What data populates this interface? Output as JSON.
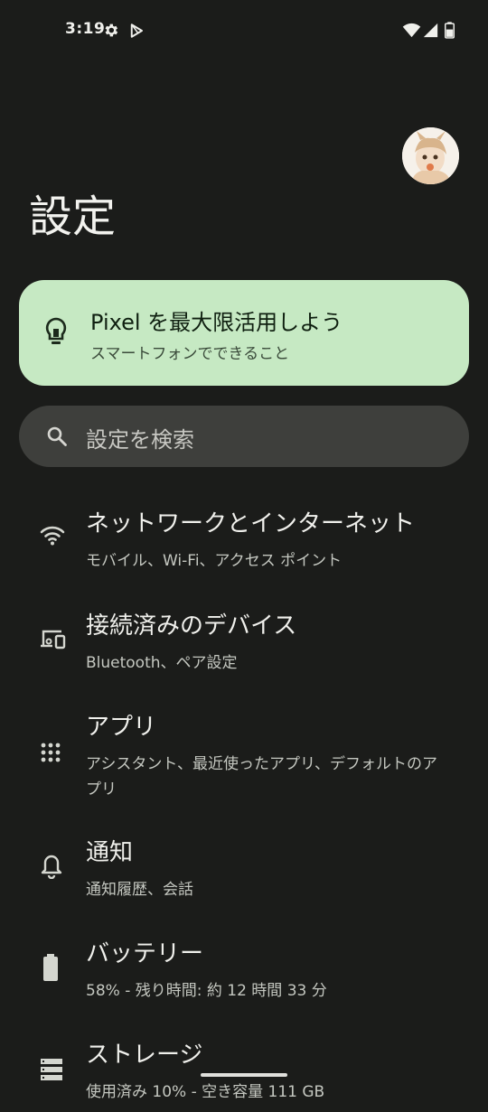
{
  "status_bar": {
    "time": "3:19",
    "icons_left": [
      "gear-icon",
      "play-store-icon"
    ],
    "icons_right": [
      "wifi-icon",
      "cellular-signal-icon",
      "battery-icon"
    ]
  },
  "header": {
    "title": "設定",
    "avatar": "profile-avatar"
  },
  "tips_card": {
    "title": "Pixel を最大限活用しよう",
    "subtitle": "スマートフォンでできること",
    "icon": "lightbulb-icon",
    "background": "#c6e9c3"
  },
  "search": {
    "placeholder": "設定を検索",
    "icon": "search-icon"
  },
  "items": [
    {
      "title": "ネットワークとインターネット",
      "summary": "モバイル、Wi-Fi、アクセス ポイント",
      "icon": "wifi-icon"
    },
    {
      "title": "接続済みのデバイス",
      "summary": "Bluetooth、ペア設定",
      "icon": "devices-icon"
    },
    {
      "title": "アプリ",
      "summary": "アシスタント、最近使ったアプリ、デフォルトのアプリ",
      "icon": "apps-grid-icon"
    },
    {
      "title": "通知",
      "summary": "通知履歴、会話",
      "icon": "bell-icon"
    },
    {
      "title": "バッテリー",
      "summary": "58% - 残り時間: 約 12 時間 33 分",
      "icon": "battery-icon"
    },
    {
      "title": "ストレージ",
      "summary": "使用済み 10% - 空き容量 111 GB",
      "icon": "storage-icon"
    }
  ],
  "colors": {
    "background": "#1b1c1a",
    "card_green": "#c6e9c3",
    "search_bg": "#3e3f3c"
  }
}
